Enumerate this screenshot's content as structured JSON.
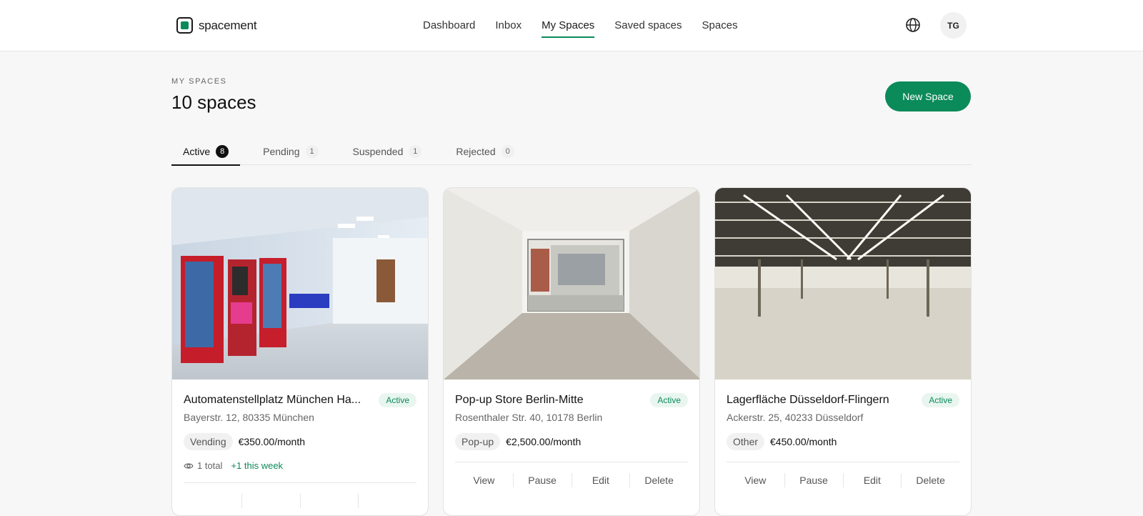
{
  "brand": {
    "name": "spacement"
  },
  "nav": {
    "items": [
      {
        "label": "Dashboard"
      },
      {
        "label": "Inbox"
      },
      {
        "label": "My Spaces"
      },
      {
        "label": "Saved spaces"
      },
      {
        "label": "Spaces"
      }
    ],
    "active": "My Spaces"
  },
  "header": {
    "language_icon": "globe-icon",
    "avatar_initials": "TG"
  },
  "page": {
    "eyebrow": "MY SPACES",
    "title": "10 spaces",
    "new_button": "New Space"
  },
  "tabs": [
    {
      "label": "Active",
      "count": "8"
    },
    {
      "label": "Pending",
      "count": "1"
    },
    {
      "label": "Suspended",
      "count": "1"
    },
    {
      "label": "Rejected",
      "count": "0"
    }
  ],
  "cards": [
    {
      "title": "Automatenstellplatz München Ha...",
      "status": "Active",
      "address": "Bayerstr. 12, 80335 München",
      "category": "Vending",
      "price": "€350.00/month",
      "views_total": "1 total",
      "views_week": "+1 this week",
      "actions": [
        "",
        "",
        "",
        ""
      ]
    },
    {
      "title": "Pop-up Store Berlin-Mitte",
      "status": "Active",
      "address": "Rosenthaler Str. 40, 10178 Berlin",
      "category": "Pop-up",
      "price": "€2,500.00/month",
      "actions": [
        "View",
        "Pause",
        "Edit",
        "Delete"
      ]
    },
    {
      "title": "Lagerfläche Düsseldorf-Flingern",
      "status": "Active",
      "address": "Ackerstr. 25, 40233 Düsseldorf",
      "category": "Other",
      "price": "€450.00/month",
      "actions": [
        "View",
        "Pause",
        "Edit",
        "Delete"
      ]
    }
  ],
  "colors": {
    "accent": "#0b8a5a",
    "text": "#111111",
    "muted": "#666666"
  }
}
